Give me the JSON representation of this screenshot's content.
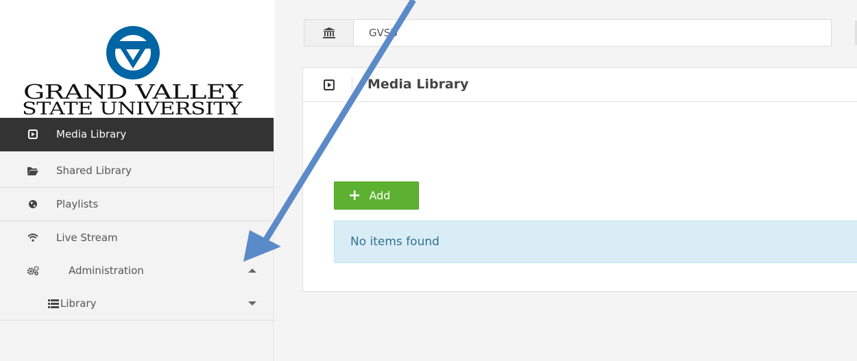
{
  "logo": {
    "line1": "GRAND VALLEY",
    "line2": "STATE UNIVERSITY"
  },
  "sidebar": {
    "items": [
      {
        "label": "Media Library",
        "icon": "play-square-icon",
        "active": true
      },
      {
        "label": "Shared Library",
        "icon": "folder-open-icon"
      },
      {
        "label": "Playlists",
        "icon": "globe-icon"
      },
      {
        "label": "Live Stream",
        "icon": "wifi-icon"
      },
      {
        "label": "Administration",
        "icon": "cogs-icon",
        "expanded": true
      },
      {
        "label": "Library",
        "icon": "list-icon",
        "expanded": false
      }
    ]
  },
  "institution": {
    "icon": "institution-icon",
    "value": "GVSU"
  },
  "panel": {
    "title": "Media Library",
    "add_label": "Add",
    "empty_message": "No items found"
  },
  "colors": {
    "gvsu_blue": "#0065a4",
    "add_green": "#5cb230",
    "active_nav": "#333333",
    "alert_bg": "#d9edf7",
    "annotation_arrow": "#5b8ac8"
  }
}
